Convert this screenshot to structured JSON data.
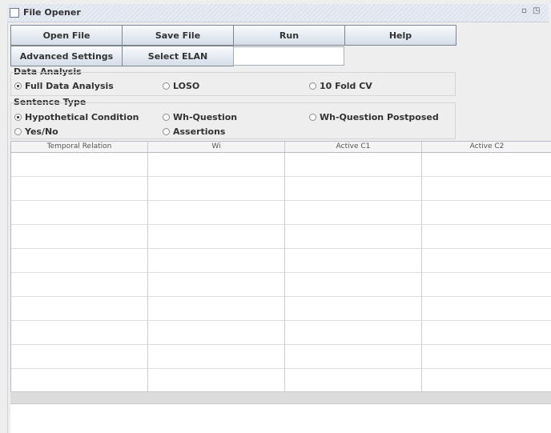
{
  "window": {
    "title": "File Opener",
    "controls": [
      "minimize-icon",
      "maximize-icon"
    ]
  },
  "toolbar": {
    "open_file": "Open File",
    "save_file": "Save File",
    "run": "Run",
    "help": "Help",
    "advanced_settings": "Advanced Settings",
    "select_elan": "Select ELAN",
    "elan_path": ""
  },
  "data_analysis": {
    "title": "Data Analysis",
    "options": [
      {
        "label": "Full Data Analysis",
        "selected": true
      },
      {
        "label": "LOSO",
        "selected": false
      },
      {
        "label": "10 Fold CV",
        "selected": false
      }
    ]
  },
  "sentence_type": {
    "title": "Sentence Type",
    "options": [
      {
        "label": "Hypothetical Condition",
        "selected": true
      },
      {
        "label": "Wh-Question",
        "selected": false
      },
      {
        "label": "Wh-Question Postposed",
        "selected": false
      },
      {
        "label": "Yes/No",
        "selected": false
      },
      {
        "label": "Assertions",
        "selected": false
      }
    ]
  },
  "table": {
    "columns": [
      "Temporal Relation",
      "Wi",
      "Active C1",
      "Active C2"
    ],
    "rows": [
      [
        "",
        "",
        "",
        ""
      ],
      [
        "",
        "",
        "",
        ""
      ],
      [
        "",
        "",
        "",
        ""
      ],
      [
        "",
        "",
        "",
        ""
      ],
      [
        "",
        "",
        "",
        ""
      ],
      [
        "",
        "",
        "",
        ""
      ],
      [
        "",
        "",
        "",
        ""
      ],
      [
        "",
        "",
        "",
        ""
      ],
      [
        "",
        "",
        "",
        ""
      ],
      [
        "",
        "",
        "",
        ""
      ]
    ]
  }
}
